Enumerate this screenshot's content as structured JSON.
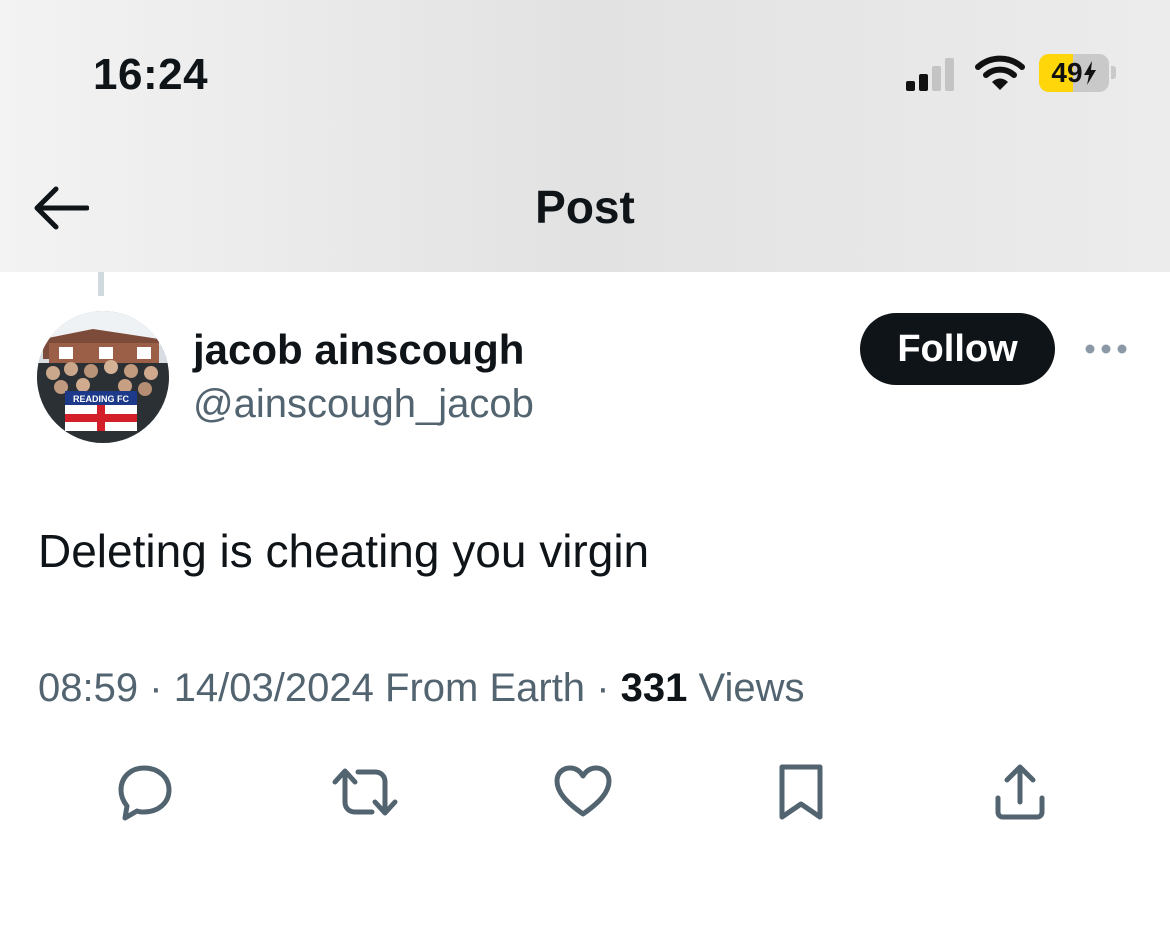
{
  "status_bar": {
    "time": "16:24",
    "battery_percent": "49",
    "battery_level": 0.49,
    "battery_color": "#ffd60a",
    "icons": [
      "signal-icon",
      "wifi-icon",
      "battery-icon",
      "charging-bolt-icon"
    ]
  },
  "nav": {
    "title": "Post",
    "back_icon": "arrow-left-icon"
  },
  "post": {
    "author_name": "jacob ainscough",
    "handle": "@ainscough_jacob",
    "follow_label": "Follow",
    "more_icon": "more-horizontal-icon",
    "avatar_banner_text": "READING FC",
    "text": "Deleting is cheating you virgin",
    "time": "08:59",
    "separator": "·",
    "date": "14/03/2024",
    "location": "From Earth",
    "views_count": "331",
    "views_label": "Views"
  },
  "actions": {
    "icons": [
      "reply-icon",
      "repost-icon",
      "like-icon",
      "bookmark-icon",
      "share-icon"
    ]
  },
  "colors": {
    "text_primary": "#0f1419",
    "text_secondary": "#536471",
    "follow_bg": "#0f1419",
    "icon": "#536471"
  }
}
